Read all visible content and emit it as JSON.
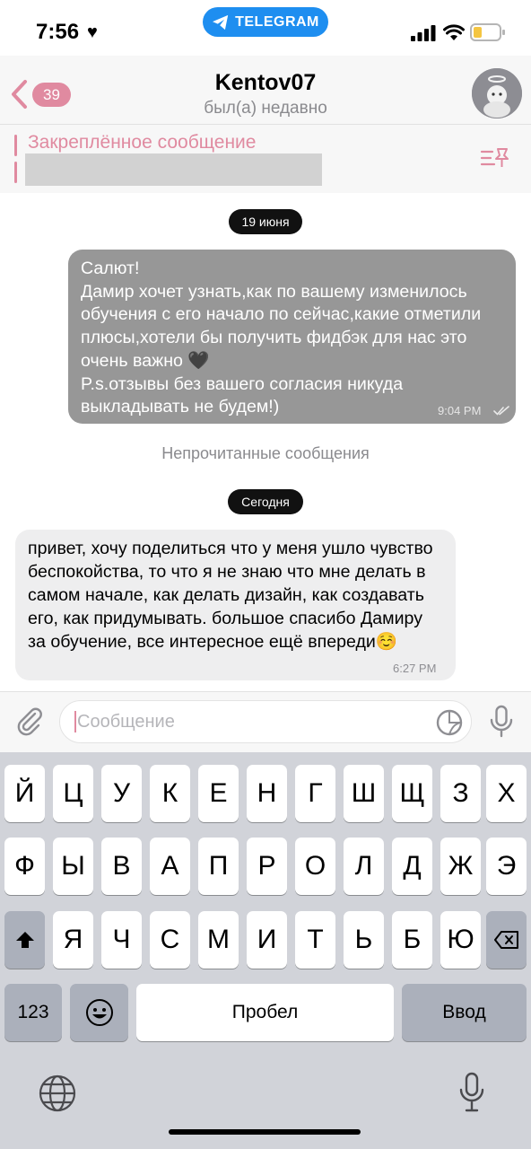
{
  "status_bar": {
    "time": "7:56",
    "app_pill": "TELEGRAM"
  },
  "header": {
    "back_count": "39",
    "name": "Kentov07",
    "status": "был(а) недавно"
  },
  "pinned": {
    "title": "Закреплённое сообщение"
  },
  "dates": {
    "first": "19 июня",
    "second": "Сегодня"
  },
  "messages": {
    "outgoing": {
      "text": "Салют!\nДамир хочет узнать,как по вашему изменилось обучения с его начало по сейчас,какие отметили плюсы,хотели бы получить фидбэк для нас это очень важно 🖤\nP.s.отзывы без вашего согласия никуда выкладывать не будем!)",
      "time": "9:04 PM"
    },
    "unread_label": "Непрочитанные сообщения",
    "incoming": {
      "text": "привет, хочу поделиться что у меня ушло чувство беспокойства, то что я не знаю что мне делать в самом начале, как делать дизайн, как создавать его, как придумывать. большое спасибо Дамиру за обучение, все интересное ещё впереди☺️",
      "time": "6:27 PM"
    }
  },
  "input": {
    "placeholder": "Сообщение",
    "value": ""
  },
  "keyboard": {
    "row1": [
      "Й",
      "Ц",
      "У",
      "К",
      "Е",
      "Н",
      "Г",
      "Ш",
      "Щ",
      "З",
      "Х"
    ],
    "row2": [
      "Ф",
      "Ы",
      "В",
      "А",
      "П",
      "Р",
      "О",
      "Л",
      "Д",
      "Ж",
      "Э"
    ],
    "row3": [
      "Я",
      "Ч",
      "С",
      "М",
      "И",
      "Т",
      "Ь",
      "Б",
      "Ю"
    ],
    "numbers": "123",
    "space": "Пробел",
    "return": "Ввод"
  }
}
